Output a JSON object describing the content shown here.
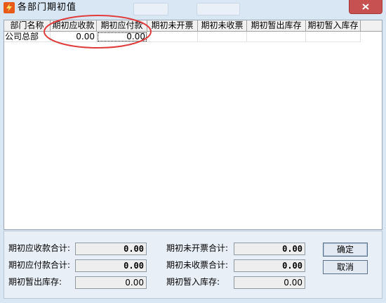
{
  "window": {
    "title": "各部门期初值"
  },
  "grid": {
    "columns": [
      "部门名称",
      "期初应收款",
      "期初应付款",
      "期初未开票",
      "期初未收票",
      "期初暂出库存",
      "期初暂入库存"
    ],
    "rows": [
      {
        "dept": "公司总部",
        "receivable": "0.00",
        "payable": "0.00",
        "unbilled": "",
        "unreceived_invoice": "",
        "temp_out": "",
        "temp_in": ""
      }
    ]
  },
  "summary": {
    "receivable_total": {
      "label": "期初应收款合计:",
      "value": "0.00"
    },
    "payable_total": {
      "label": "期初应付款合计:",
      "value": "0.00"
    },
    "temp_out_stock": {
      "label": "期初暂出库存:",
      "value": "0.00"
    },
    "unbilled_total": {
      "label": "期初未开票合计:",
      "value": "0.00"
    },
    "unreceived_total": {
      "label": "期初未收票合计:",
      "value": "0.00"
    },
    "temp_in_stock": {
      "label": "期初暂入库存:",
      "value": "0.00"
    }
  },
  "buttons": {
    "ok": "确定",
    "cancel": "取消"
  },
  "icons": {
    "app": "app-icon",
    "close": "close-icon"
  },
  "colors": {
    "annotation": "#e03c3c",
    "close": "#c75050",
    "window_bg": "#d9e7f5"
  }
}
